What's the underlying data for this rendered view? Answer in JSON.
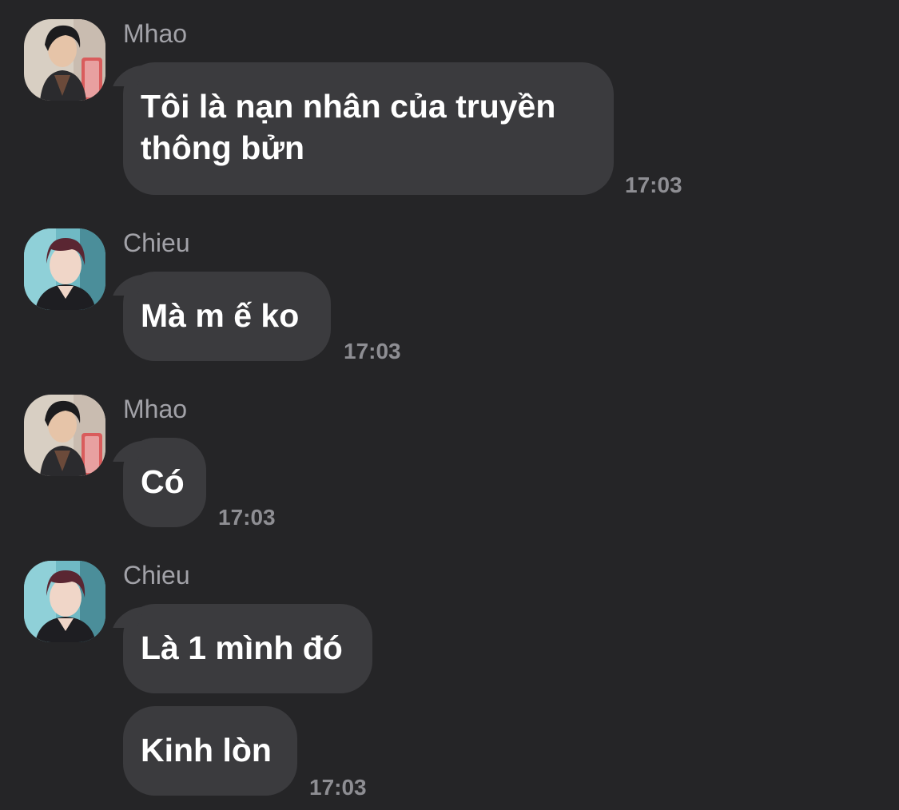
{
  "conversation": [
    {
      "sender": "Mhao",
      "avatar_icon": "mhao-avatar",
      "messages": [
        {
          "line1": "Tôi là nạn nhân của truyền",
          "line2": "thông bửn"
        }
      ],
      "time": "17:03"
    },
    {
      "sender": "Chieu",
      "avatar_icon": "chieu-avatar",
      "messages": [
        {
          "text": "Mà m ế ko"
        }
      ],
      "time": "17:03"
    },
    {
      "sender": "Mhao",
      "avatar_icon": "mhao-avatar",
      "messages": [
        {
          "text": "Có"
        }
      ],
      "time": "17:03"
    },
    {
      "sender": "Chieu",
      "avatar_icon": "chieu-avatar",
      "messages": [
        {
          "text": "Là 1 mình đó"
        },
        {
          "text": "Kinh lòn"
        }
      ],
      "time": "17:03"
    }
  ],
  "colors": {
    "background": "#252527",
    "bubble": "#3b3b3e",
    "sender_name": "#a2a2a8",
    "timestamp": "#8e8e93",
    "message_text": "#ffffff"
  }
}
